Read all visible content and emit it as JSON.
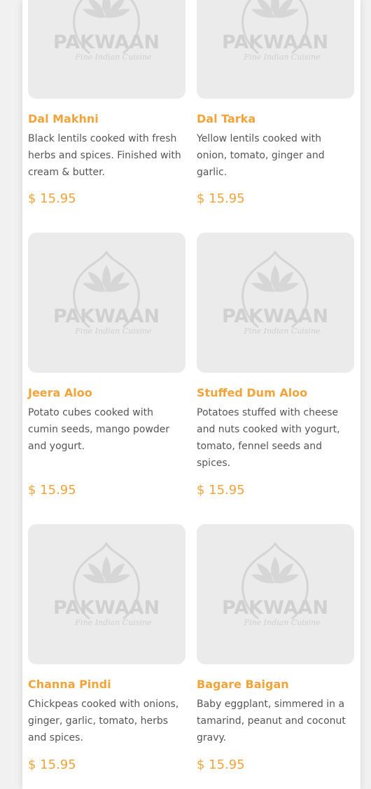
{
  "brand": {
    "logo_text": "PAKWAAN",
    "logo_tagline": "Fine Indian Cuisine"
  },
  "colors": {
    "accent": "#f2a33a",
    "placeholder_bg": "#ebebeb",
    "text": "#555555"
  },
  "menu_items": [
    {
      "name": "Dal Makhni",
      "description": "Black lentils cooked with fresh herbs and spices. Finished with cream & butter.",
      "price": "$ 15.95"
    },
    {
      "name": "Dal Tarka",
      "description": "Yellow lentils cooked with onion, tomato, ginger and garlic.",
      "price": "$ 15.95"
    },
    {
      "name": "Jeera Aloo",
      "description": "Potato cubes cooked with cumin seeds, mango powder and yogurt.",
      "price": "$ 15.95"
    },
    {
      "name": "Stuffed Dum Aloo",
      "description": "Potatoes stuffed with cheese and nuts cooked with yogurt, tomato, fennel seeds and spices.",
      "price": "$ 15.95"
    },
    {
      "name": "Channa Pindi",
      "description": "Chickpeas cooked with onions, ginger, garlic, tomato, herbs and spices.",
      "price": "$ 15.95"
    },
    {
      "name": "Bagare Baigan",
      "description": "Baby eggplant, simmered in a tamarind, peanut and coconut gravy.",
      "price": "$ 15.95"
    }
  ]
}
